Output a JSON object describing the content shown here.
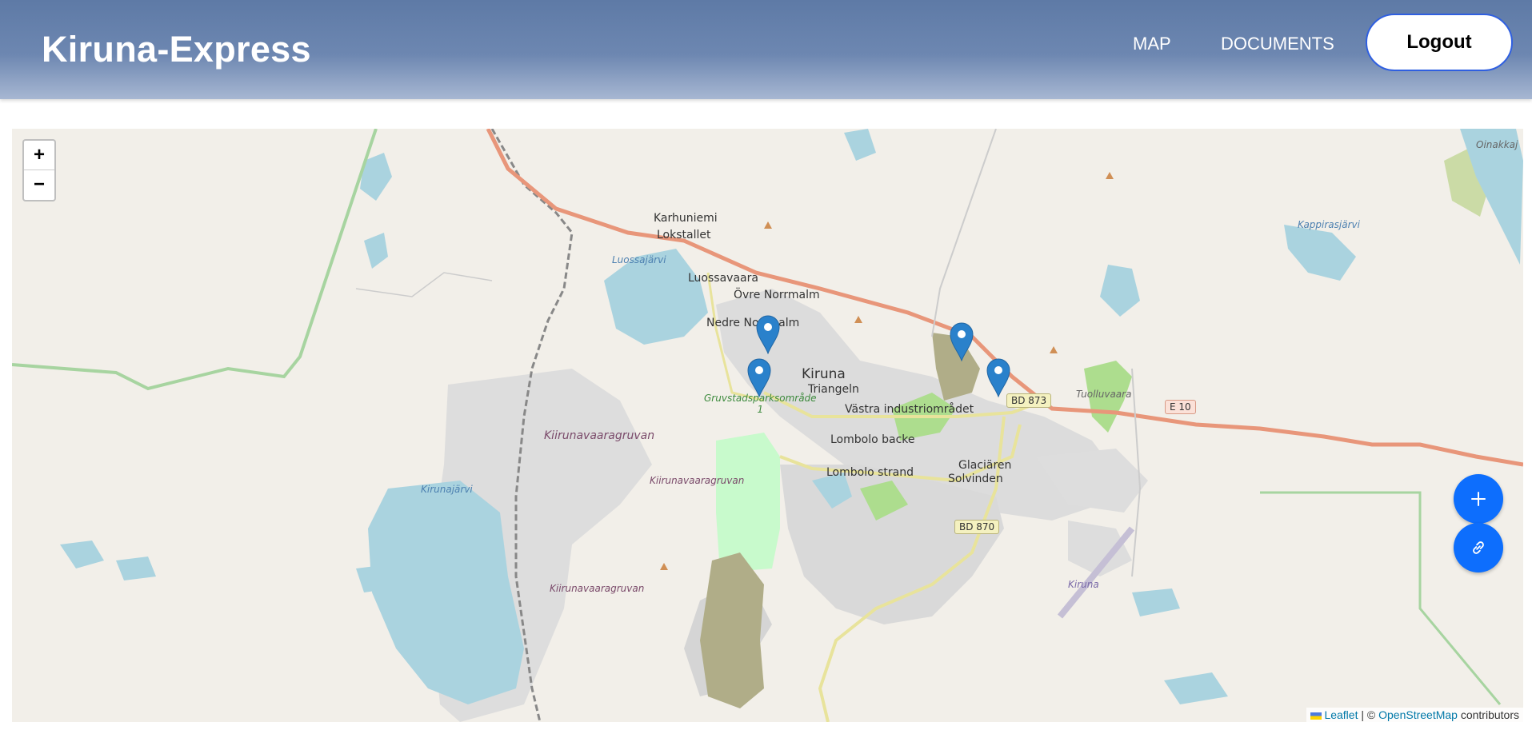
{
  "header": {
    "brand": "Kiruna-Express",
    "nav": {
      "map": "MAP",
      "documents": "DOCUMENTS"
    },
    "logout_label": "Logout"
  },
  "map": {
    "zoom_in_label": "+",
    "zoom_out_label": "−",
    "labels": {
      "karhuniemi": "Karhuniemi",
      "lokstallet": "Lokstallet",
      "luossajarvi": "Luossajärvi",
      "luossavaara": "Luossavaara",
      "ovre_norrmalm": "Övre Norrmalm",
      "nedre_norrmalm": "Nedre Norrmalm",
      "kiruna": "Kiruna",
      "triangeln": "Triangeln",
      "gruvstads": "Gruvstadsparksområde\n1",
      "vastra": "Västra industriområdet",
      "lombolo_backe": "Lombolo backe",
      "lombolo_strand": "Lombolo strand",
      "glaciaren": "Glaciären",
      "solvinden": "Solvinden",
      "kiirunavaaragruvan_1": "Kiirunavaaragruvan",
      "kiirunavaaragruvan_2": "Kiirunavaaragruvan",
      "kiirunavaaragruvan_3": "Kiirunavaaragruvan",
      "kirunajarvi": "Kirunajärvi",
      "kappirasjarvi": "Kappirasjärvi",
      "tuolluvaara": "Tuolluvaara",
      "oinakkaj": "Oinakkaj",
      "kiruna_airport": "Kiruna"
    },
    "road_shields": {
      "bd873": "BD 873",
      "e10": "E 10",
      "bd870": "BD 870"
    },
    "attribution": {
      "leaflet": "Leaflet",
      "separator": " | © ",
      "osm": "OpenStreetMap",
      "suffix": " contributors"
    },
    "marker_color": "#2a81cb"
  },
  "fab": {
    "add_icon": "plus-icon",
    "link_icon": "link-icon",
    "color": "#0d6efd"
  }
}
